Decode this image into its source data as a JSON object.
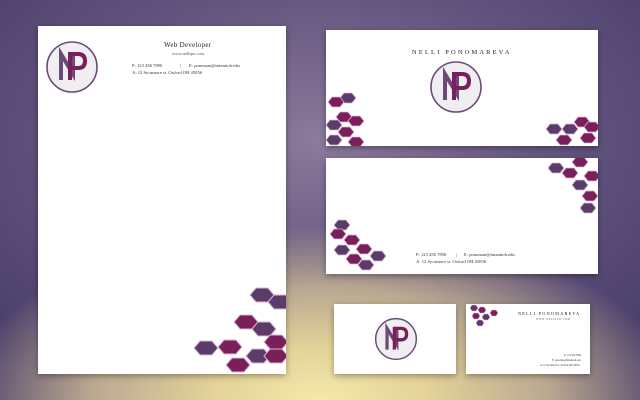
{
  "brand": {
    "initials": "NP",
    "name": "NELLI PONOMAREVA",
    "title": "Web Developer",
    "website": "www.nellipo.com",
    "website_spaced": "W W W . N E L L I P O . C O M",
    "phone": "P: 123 456 7890",
    "email": "E: ponoman@miamioh.edu",
    "address": "A: 12 Sycamore st. Oxford OH 45056",
    "separator": "|"
  },
  "colors": {
    "magenta": "#7a1f5c",
    "plum": "#5a3b6a",
    "hex_stroke": "#d9b8d1",
    "monogram_ring": "#6b4a78",
    "monogram_fill": "#f0eef1",
    "background_top": "#4a3e6a",
    "background_glow": "#f4e9a8"
  },
  "icons": {
    "monogram": "np-monogram-logo",
    "hexagon": "hexagon-pattern"
  }
}
